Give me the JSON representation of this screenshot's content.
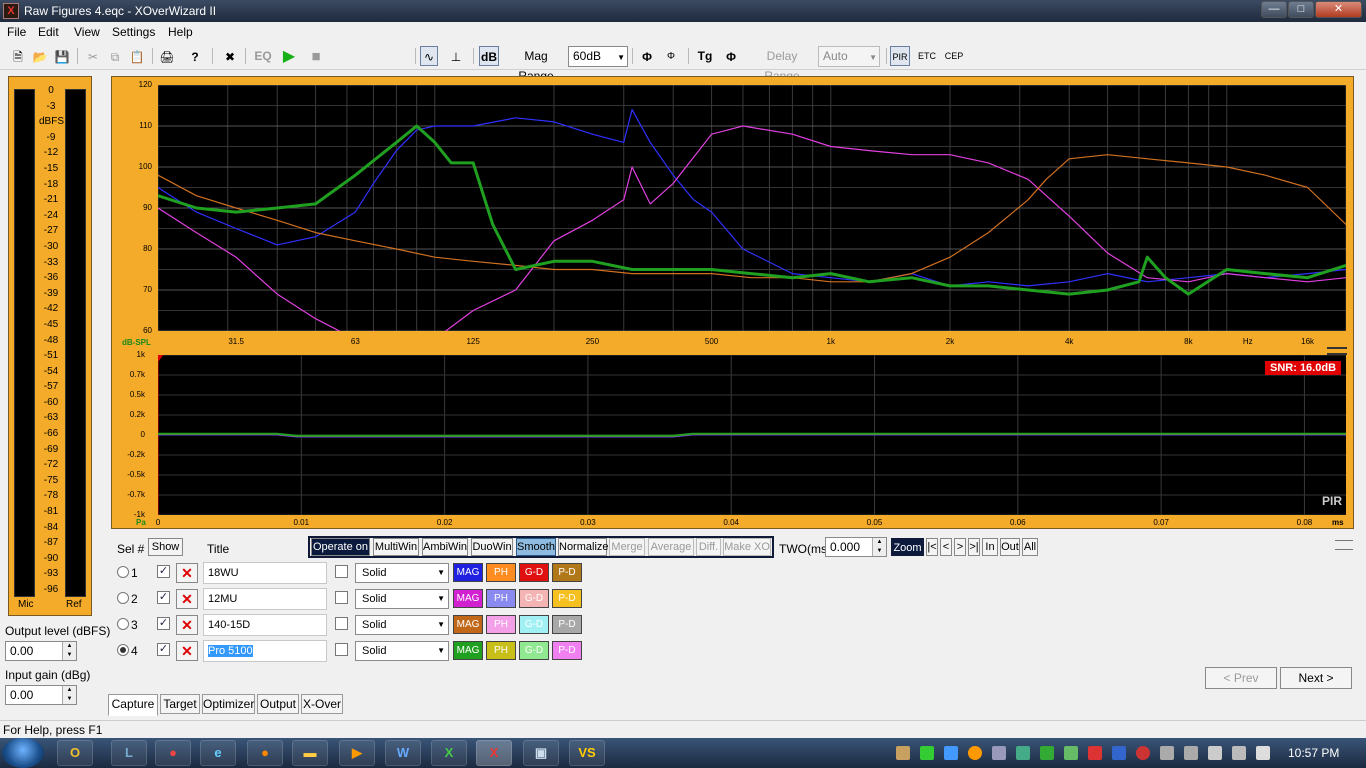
{
  "window": {
    "title": "Raw Figures 4.eqc - XOverWizard II"
  },
  "menu": [
    "File",
    "Edit",
    "View",
    "Settings",
    "Help"
  ],
  "toolbar": {
    "eq_label": "EQ",
    "db_label": "dB",
    "mag_range_label": "Mag Range",
    "mag_range_value": "60dB",
    "tg_label": "Tg",
    "delay_range_label": "Delay Range",
    "delay_range_value": "Auto",
    "pir_label": "PIR",
    "etc_label": "ETC",
    "cep_label": "CEP"
  },
  "meter": {
    "ticks": [
      "0",
      "-3",
      "dBFS",
      "-9",
      "-12",
      "-15",
      "-18",
      "-21",
      "-24",
      "-27",
      "-30",
      "-33",
      "-36",
      "-39",
      "-42",
      "-45",
      "-48",
      "-51",
      "-54",
      "-57",
      "-60",
      "-63",
      "-66",
      "-69",
      "-72",
      "-75",
      "-78",
      "-81",
      "-84",
      "-87",
      "-90",
      "-93",
      "-96"
    ],
    "left_label": "Mic",
    "right_label": "Ref"
  },
  "output_level": {
    "label": "Output level (dBFS)",
    "value": "0.00"
  },
  "input_gain": {
    "label": "Input gain (dBg)",
    "value": "0.00"
  },
  "freq_chart": {
    "y_unit": "dB-SPL",
    "y_ticks": [
      "120",
      "110",
      "100",
      "90",
      "80",
      "70",
      "60"
    ],
    "x_ticks": [
      "31.5",
      "63",
      "125",
      "250",
      "500",
      "1k",
      "2k",
      "4k",
      "8k",
      "Hz",
      "16k"
    ]
  },
  "time_chart": {
    "y_unit": "Pa",
    "y_ticks": [
      "1k",
      "0.7k",
      "0.5k",
      "0.2k",
      "0",
      "-0.2k",
      "-0.5k",
      "-0.7k",
      "-1k"
    ],
    "x_ticks": [
      "0",
      "0.01",
      "0.02",
      "0.03",
      "0.04",
      "0.05",
      "0.06",
      "0.07",
      "0.08"
    ],
    "x_unit": "ms",
    "snr": "SNR: 16.0dB",
    "mode": "PIR"
  },
  "chart_data": {
    "type": "line",
    "title": "",
    "xlabel": "Hz",
    "ylabel": "dB-SPL",
    "x_scale": "log",
    "xlim": [
      20,
      20000
    ],
    "ylim": [
      60,
      120
    ],
    "grid": true,
    "series": [
      {
        "name": "18WU",
        "color": "#3030ff",
        "x": [
          20,
          25,
          31.5,
          40,
          50,
          63,
          70,
          80,
          90,
          100,
          125,
          160,
          200,
          250,
          300,
          315,
          350,
          400,
          450,
          500,
          600,
          800,
          1000,
          1250,
          1600,
          2000,
          2500,
          3150,
          4000,
          5000,
          6300,
          8000,
          10000,
          12500,
          16000,
          20000
        ],
        "y": [
          95,
          89,
          85,
          81,
          83,
          89,
          96,
          104,
          109,
          110,
          110,
          112,
          111,
          108,
          106,
          114,
          106,
          98,
          92,
          89,
          80,
          74,
          73,
          72,
          74,
          71,
          72,
          71,
          72,
          74,
          72,
          73,
          74,
          73,
          74,
          75
        ]
      },
      {
        "name": "12MU",
        "color": "#e040e0",
        "x": [
          20,
          25,
          31.5,
          40,
          50,
          63,
          70,
          80,
          100,
          125,
          160,
          200,
          250,
          300,
          315,
          350,
          400,
          500,
          600,
          800,
          1000,
          1250,
          1600,
          2000,
          2500,
          3150,
          4000,
          5000,
          6300,
          8000,
          10000,
          12500,
          16000,
          20000
        ],
        "y": [
          90,
          84,
          78,
          69,
          63,
          58,
          60,
          56,
          58,
          65,
          70,
          82,
          87,
          92,
          100,
          91,
          96,
          108,
          110,
          108,
          105,
          104,
          103,
          103,
          101,
          97,
          88,
          79,
          73,
          72,
          74,
          73,
          72,
          73
        ]
      },
      {
        "name": "140-15D",
        "color": "#d07020",
        "x": [
          20,
          25,
          31.5,
          40,
          50,
          63,
          80,
          100,
          125,
          160,
          200,
          250,
          315,
          400,
          500,
          630,
          800,
          1000,
          1250,
          1600,
          2000,
          2500,
          3150,
          3500,
          4000,
          5000,
          6300,
          8000,
          10000,
          12500,
          16000,
          20000
        ],
        "y": [
          98,
          93,
          90,
          87,
          84,
          82,
          80,
          78,
          77,
          76,
          75,
          75,
          74,
          74,
          74,
          73,
          73,
          72,
          72,
          74,
          78,
          84,
          92,
          97,
          102,
          103,
          102,
          101,
          100,
          98,
          95,
          86
        ]
      },
      {
        "name": "Pro 5100",
        "color": "#20a020",
        "x": [
          20,
          25,
          31.5,
          40,
          50,
          63,
          80,
          90,
          100,
          110,
          125,
          140,
          160,
          200,
          250,
          315,
          400,
          500,
          630,
          800,
          1000,
          1250,
          1600,
          2000,
          2500,
          3150,
          4000,
          5000,
          6000,
          6300,
          7000,
          8000,
          10000,
          12500,
          16000,
          20000
        ],
        "y": [
          93,
          90,
          89,
          90,
          91,
          98,
          106,
          110,
          106,
          101,
          101,
          86,
          75,
          77,
          77,
          75,
          75,
          75,
          74,
          73,
          74,
          72,
          73,
          71,
          71,
          70,
          69,
          70,
          72,
          78,
          73,
          69,
          75,
          74,
          73,
          76
        ]
      }
    ]
  },
  "controls": {
    "sel_label": "Sel #",
    "show_label": "Show",
    "title_label": "Title",
    "operate_on": "Operate on",
    "multiwin": "MultiWin",
    "ambiwin": "AmbiWin",
    "duowin": "DuoWin",
    "smooth": "Smooth",
    "normalize": "Normalize",
    "merge": "Merge",
    "average": "Average",
    "diff": "Diff.",
    "make_xo": "Make XO",
    "two_label": "TWO(ms)",
    "two_value": "0.000",
    "zoom_label": "Zoom",
    "zoom_btns": [
      "|<",
      "<",
      ">",
      ">|",
      "In",
      "Out",
      "All"
    ]
  },
  "traces": [
    {
      "num": "1",
      "title": "18WU",
      "style": "Solid",
      "selected": false,
      "btns": [
        {
          "label": "MAG",
          "bg": "#2020e0",
          "fg": "#ffffff"
        },
        {
          "label": "PH",
          "bg": "#ff8c20",
          "fg": "#ffffff"
        },
        {
          "label": "G-D",
          "bg": "#e01010",
          "fg": "#ffffff"
        },
        {
          "label": "P-D",
          "bg": "#b07818",
          "fg": "#ffffff"
        }
      ]
    },
    {
      "num": "2",
      "title": "12MU",
      "style": "Solid",
      "selected": false,
      "btns": [
        {
          "label": "MAG",
          "bg": "#d020d0",
          "fg": "#ffffff"
        },
        {
          "label": "PH",
          "bg": "#8a8af0",
          "fg": "#ffffff"
        },
        {
          "label": "G-D",
          "bg": "#f4b4b4",
          "fg": "#ffffff"
        },
        {
          "label": "P-D",
          "bg": "#f6c020",
          "fg": "#ffffff"
        }
      ]
    },
    {
      "num": "3",
      "title": "140-15D",
      "style": "Solid",
      "selected": false,
      "btns": [
        {
          "label": "MAG",
          "bg": "#c06818",
          "fg": "#ffffff"
        },
        {
          "label": "PH",
          "bg": "#f4a0e8",
          "fg": "#ffffff"
        },
        {
          "label": "G-D",
          "bg": "#a0f0f4",
          "fg": "#ffffff"
        },
        {
          "label": "P-D",
          "bg": "#a8a8a8",
          "fg": "#ffffff"
        }
      ]
    },
    {
      "num": "4",
      "title": "Pro 5100",
      "style": "Solid",
      "selected": true,
      "btns": [
        {
          "label": "MAG",
          "bg": "#20a020",
          "fg": "#ffffff"
        },
        {
          "label": "PH",
          "bg": "#c8c018",
          "fg": "#ffffff"
        },
        {
          "label": "G-D",
          "bg": "#90e890",
          "fg": "#ffffff"
        },
        {
          "label": "P-D",
          "bg": "#f080f0",
          "fg": "#ffffff"
        }
      ]
    }
  ],
  "nav": {
    "prev": "< Prev",
    "next": "Next >"
  },
  "tabs": [
    "Capture",
    "Target",
    "Optimizer",
    "Output",
    "X-Over"
  ],
  "status": "For Help, press F1",
  "clock": "10:57 PM"
}
